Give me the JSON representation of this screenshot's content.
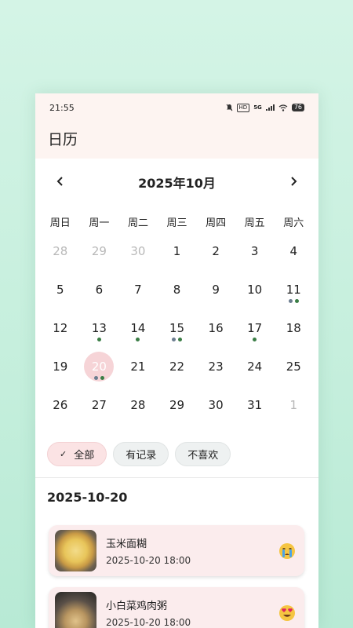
{
  "status": {
    "time": "21:55",
    "battery": "76",
    "hd": "HD",
    "network": "5G"
  },
  "header": {
    "title": "日历"
  },
  "calendar": {
    "month_title": "2025年10月",
    "weekdays": [
      "周日",
      "周一",
      "周二",
      "周三",
      "周四",
      "周五",
      "周六"
    ],
    "days": [
      "28",
      "29",
      "30",
      "1",
      "2",
      "3",
      "4",
      "5",
      "6",
      "7",
      "8",
      "9",
      "10",
      "11",
      "12",
      "13",
      "14",
      "15",
      "16",
      "17",
      "18",
      "19",
      "20",
      "21",
      "22",
      "23",
      "24",
      "25",
      "26",
      "27",
      "28",
      "29",
      "30",
      "31",
      "1"
    ],
    "dot_colors": {
      "green": "#3a7d45",
      "slate": "#6b7d8f"
    }
  },
  "filters": {
    "all": "全部",
    "recorded": "有记录",
    "disliked": "不喜欢"
  },
  "selected_date": "2025-10-20",
  "entries": [
    {
      "name": "玉米面糊",
      "time": "2025-10-20 18:00",
      "mood": "crying-face"
    },
    {
      "name": "小白菜鸡肉粥",
      "time": "2025-10-20 18:00",
      "mood": "heart-eyes-face"
    }
  ],
  "colors": {
    "background": "#c6efdd",
    "header_bg": "#fdf4f1",
    "selected_day": "#f6d4d7",
    "card_bg": "#fbeced",
    "active_chip": "#fbe3e4"
  }
}
